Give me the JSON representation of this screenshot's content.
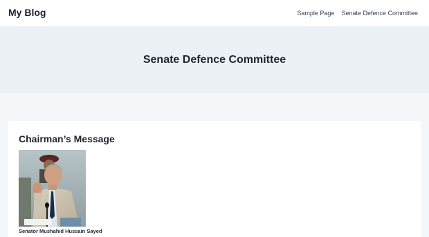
{
  "header": {
    "site_title": "My Blog",
    "nav": [
      {
        "label": "Sample Page"
      },
      {
        "label": "Senate Defence Committee"
      }
    ]
  },
  "hero": {
    "title": "Senate Defence Committee"
  },
  "content": {
    "heading": "Chairman’s Message",
    "portrait_caption": "Senator Mushahid Hussain Sayed"
  }
}
